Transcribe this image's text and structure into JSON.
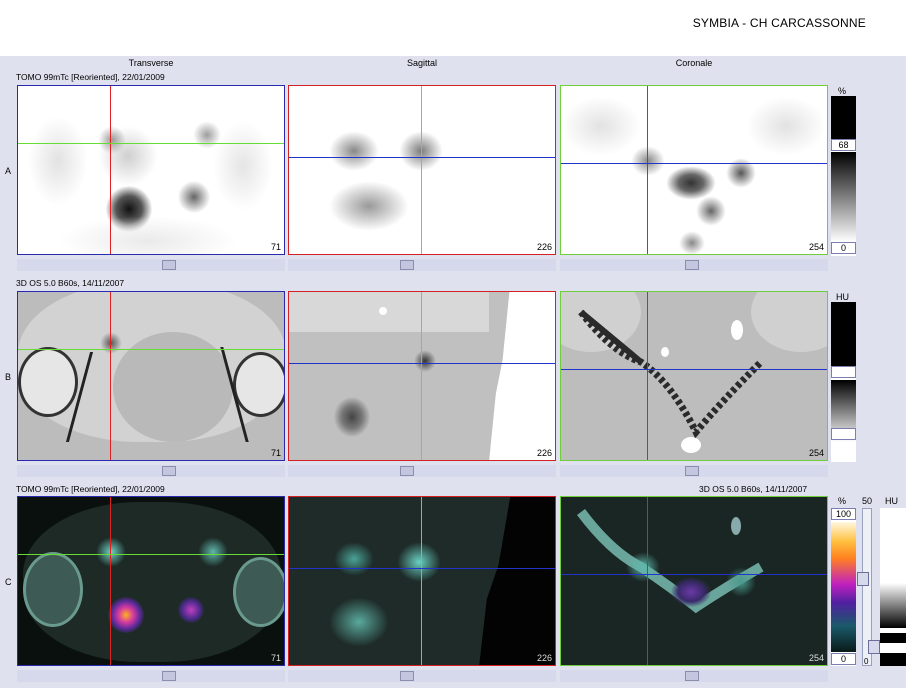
{
  "header": {
    "title": "SYMBIA - CH CARCASSONNE"
  },
  "columns": [
    "Transverse",
    "Sagittal",
    "Coronale"
  ],
  "rows": [
    {
      "label": "A",
      "info_left": "TOMO 99mTc [Reoriented], 22/01/2009",
      "info_right": ""
    },
    {
      "label": "B",
      "info_left": "3D  OS  5.0  B60s, 14/11/2007",
      "info_right": ""
    },
    {
      "label": "C",
      "info_left": "TOMO 99mTc [Reoriented], 22/01/2009",
      "info_right": "3D  OS  5.0  B60s, 14/11/2007"
    }
  ],
  "slice_numbers": [
    "71",
    "226",
    "254"
  ],
  "scales": {
    "a": {
      "unit": "%",
      "top": "68",
      "bottom": "0"
    },
    "b": {
      "unit": "HU"
    },
    "c": {
      "unit_pct": "%",
      "top": "100",
      "bottom": "0",
      "window": "50",
      "unit_hu": "HU",
      "low": "0"
    }
  },
  "colors": {
    "transverse_frame": "#2a2ab0",
    "sagittal_frame": "#d42020",
    "coronal_frame": "#6fcf3a",
    "crosshair_red": "#dd2222",
    "crosshair_green": "#66dd33",
    "crosshair_blue": "#2233cc"
  }
}
